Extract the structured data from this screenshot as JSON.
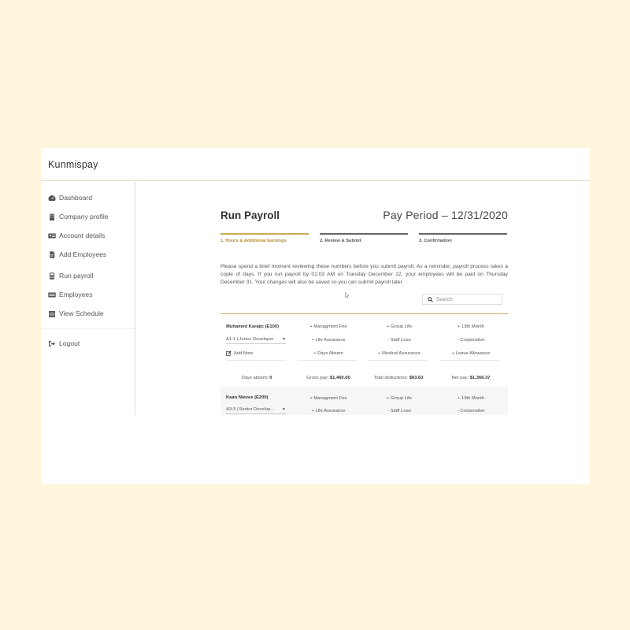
{
  "app": {
    "title": "Kunmispay"
  },
  "sidebar": {
    "items": [
      {
        "label": "Dashboard",
        "icon": "dashboard-icon"
      },
      {
        "label": "Company profile",
        "icon": "building-icon"
      },
      {
        "label": "Account details",
        "icon": "id-card-icon"
      },
      {
        "label": "Add Employees",
        "icon": "file-icon"
      },
      {
        "label": "Run payroll",
        "icon": "calculator-icon"
      },
      {
        "label": "Employees",
        "icon": "users-icon"
      },
      {
        "label": "View Schedule",
        "icon": "calendar-icon"
      },
      {
        "label": "Logout",
        "icon": "logout-icon"
      }
    ]
  },
  "main": {
    "title": "Run Payroll",
    "pay_period": "Pay Period – 12/31/2020",
    "steps": [
      {
        "label": "1. Hours & Additional Earnings",
        "active": true
      },
      {
        "label": "2. Review & Submit",
        "active": false
      },
      {
        "label": "3. Confirmation",
        "active": false
      }
    ],
    "intro": "Please spend a brief moment reviewing these numbers before you submit payroll. As a reminder, payroll process takes a cople of days. If you run payroll by 01:03 AM on Tuesday December 22, your employees will be paid on Thursday December 31. Your changes will also be saved so you can submit payroll later.",
    "search": {
      "placeholder": "Search"
    },
    "colors": {
      "accent": "#c9a95b",
      "background": "#fdf6dc"
    }
  },
  "employees": [
    {
      "name": "Muhamed Karajic (E100)",
      "role": "A1:1 | Junior Developer",
      "add_note": "Add Note",
      "col1": [
        "+ Managment Fee",
        "+ Life Assurance",
        "+ Days Absent"
      ],
      "col2": [
        "+ Group Life",
        "- Staff Loan",
        "+ Medical Assurance"
      ],
      "col3": [
        "+ 13th Month",
        "- Cooperative",
        "+ Leave Allowance"
      ],
      "summary": {
        "days_label": "Days absent:",
        "days_value": "0",
        "gross_label": "Gross pay:",
        "gross_value": "$1,460.00",
        "deductions_label": "Total deductions:",
        "deductions_value": "$93.63",
        "net_label": "Net pay:",
        "net_value": "$1,366.37"
      }
    },
    {
      "name": "Kaan Nieves (E200)",
      "role": "A3:3 | Senior Develop...",
      "col1": [
        "+ Managment Fee",
        "+ Life Assurance"
      ],
      "col2": [
        "+ Group Life",
        "- Staff Loan"
      ],
      "col3": [
        "+ 13th Month",
        "- Cooperative"
      ]
    }
  ]
}
